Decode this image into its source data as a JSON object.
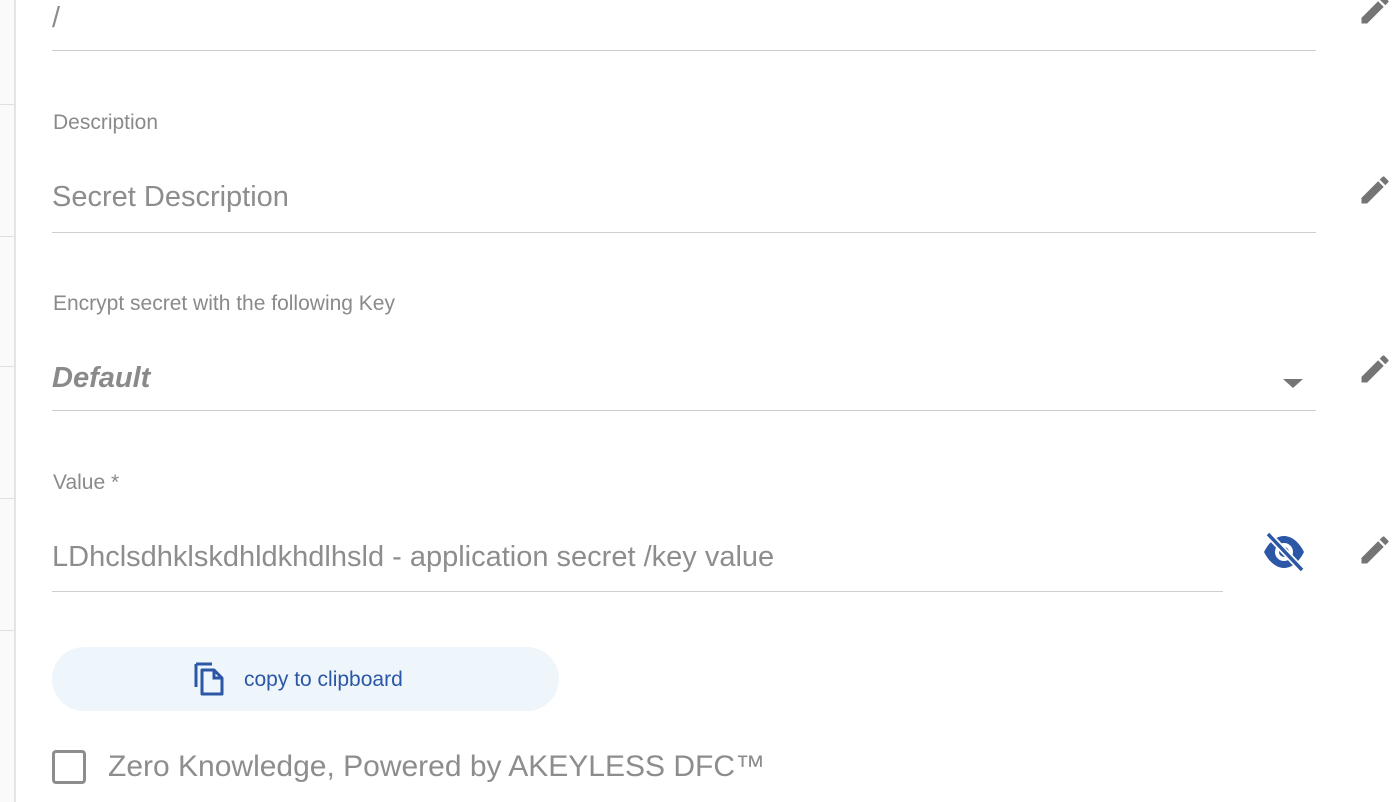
{
  "path_field": {
    "value": "/"
  },
  "description": {
    "label": "Description",
    "placeholder": "Secret Description"
  },
  "encryption_key": {
    "label": "Encrypt secret with the following Key",
    "selected": "Default"
  },
  "value_field": {
    "label": "Value *",
    "value": "LDhclsdhklskdhldkhdlhsld - application secret /key value"
  },
  "copy_button": {
    "label": "copy to clipboard"
  },
  "zero_knowledge": {
    "label": "Zero Knowledge, Powered by AKEYLESS DFC™",
    "checked": false
  },
  "icons": {
    "edit": "pencil-icon",
    "dropdown": "caret-down-icon",
    "visibility": "eye-off-icon",
    "copy": "copy-icon"
  },
  "colors": {
    "accent": "#2b57a6",
    "copy_bg": "#eef5fb",
    "text_muted": "#8a8a8a",
    "icon_gray": "#757575"
  }
}
